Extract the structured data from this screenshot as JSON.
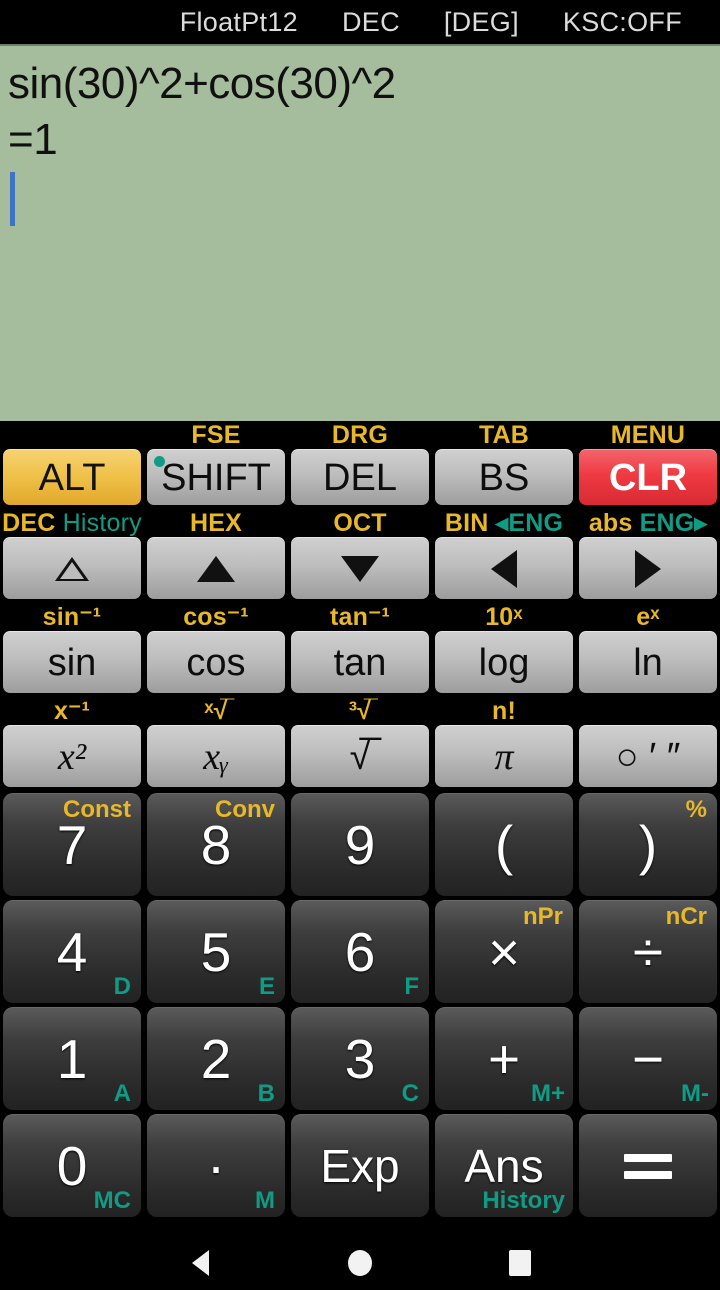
{
  "status_bar": {
    "items": [
      {
        "label": "FloatPt12"
      },
      {
        "label": "DEC"
      },
      {
        "label": "[DEG]"
      },
      {
        "label": "KSC:OFF"
      }
    ]
  },
  "display": {
    "expression": "sin(30)^2+cos(30)^2",
    "result": "=1",
    "background_color": "#a6bd9d",
    "caret_color": "#3d74c4"
  },
  "colors": {
    "gold": "#e8b828",
    "teal": "#0f9b84",
    "red": "#ef3a42",
    "alt_gold": "#f0c24a"
  },
  "keypad": {
    "row1": {
      "labels": [
        "",
        "FSE",
        "DRG",
        "TAB",
        "MENU"
      ],
      "keys": [
        {
          "label": "ALT",
          "style": "gold"
        },
        {
          "label": "SHIFT",
          "style": "gray",
          "indicator": "shift-active-dot"
        },
        {
          "label": "DEL",
          "style": "gray"
        },
        {
          "label": "BS",
          "style": "gray"
        },
        {
          "label": "CLR",
          "style": "red"
        }
      ]
    },
    "row2": {
      "labels": [
        {
          "gold": "DEC",
          "teal": "History"
        },
        {
          "gold": "HEX",
          "teal": ""
        },
        {
          "gold": "OCT",
          "teal": ""
        },
        {
          "gold": "BIN",
          "teal": "◂ENG"
        },
        {
          "gold": "abs",
          "teal": "ENG▸"
        }
      ],
      "keys": [
        {
          "icon": "triangle-up-outline-icon"
        },
        {
          "icon": "triangle-up-icon"
        },
        {
          "icon": "triangle-down-icon"
        },
        {
          "icon": "triangle-left-icon"
        },
        {
          "icon": "triangle-right-icon"
        }
      ]
    },
    "row3": {
      "labels": [
        "sin⁻¹",
        "cos⁻¹",
        "tan⁻¹",
        "10ˣ",
        "eˣ"
      ],
      "keys": [
        {
          "label": "sin"
        },
        {
          "label": "cos"
        },
        {
          "label": "tan"
        },
        {
          "label": "log"
        },
        {
          "label": "ln"
        }
      ]
    },
    "row4": {
      "labels": [
        "x⁻¹",
        "ˣ√̅",
        "³√̅",
        "n!",
        ""
      ],
      "keys": [
        {
          "label": "x²"
        },
        {
          "label": "xᵧ"
        },
        {
          "label": "√̅"
        },
        {
          "label": "π"
        },
        {
          "label": "○ ′ ″"
        }
      ]
    },
    "row5": [
      {
        "main": "7",
        "top_right": "Const",
        "bottom_right": ""
      },
      {
        "main": "8",
        "top_right": "Conv",
        "bottom_right": ""
      },
      {
        "main": "9",
        "top_right": "",
        "bottom_right": ""
      },
      {
        "main": "(",
        "top_right": "",
        "bottom_right": ""
      },
      {
        "main": ")",
        "top_right": "%",
        "bottom_right": ""
      }
    ],
    "row6": [
      {
        "main": "4",
        "top_right": "",
        "bottom_right": "D"
      },
      {
        "main": "5",
        "top_right": "",
        "bottom_right": "E"
      },
      {
        "main": "6",
        "top_right": "",
        "bottom_right": "F"
      },
      {
        "main": "×",
        "top_right": "nPr",
        "bottom_right": ""
      },
      {
        "main": "÷",
        "top_right": "nCr",
        "bottom_right": ""
      }
    ],
    "row7": [
      {
        "main": "1",
        "top_right": "",
        "bottom_right": "A"
      },
      {
        "main": "2",
        "top_right": "",
        "bottom_right": "B"
      },
      {
        "main": "3",
        "top_right": "",
        "bottom_right": "C"
      },
      {
        "main": "+",
        "top_right": "",
        "bottom_right": "M+"
      },
      {
        "main": "−",
        "top_right": "",
        "bottom_right": "M-"
      }
    ],
    "row8": [
      {
        "main": "0",
        "top_right": "",
        "bottom_right": "MC"
      },
      {
        "main": "·",
        "top_right": "",
        "bottom_right": "M"
      },
      {
        "main": "Exp",
        "top_right": "",
        "bottom_right": ""
      },
      {
        "main": "Ans",
        "top_right": "",
        "bottom_right": "History"
      },
      {
        "main": "=",
        "top_right": "",
        "bottom_right": ""
      }
    ]
  },
  "nav_bar": {
    "back": "back-icon",
    "home": "home-icon",
    "recents": "recents-icon"
  }
}
